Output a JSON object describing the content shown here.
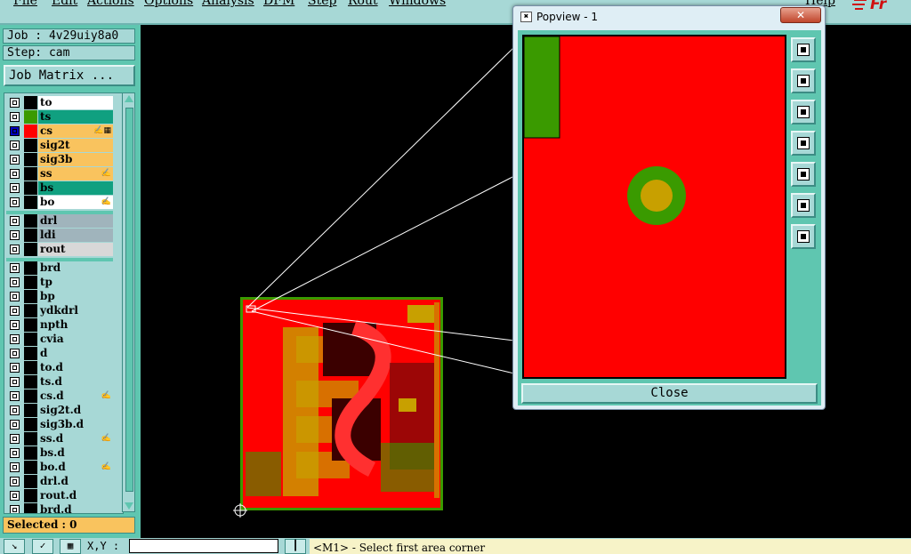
{
  "menu": {
    "items": [
      "File",
      "Edit",
      "Actions",
      "Options",
      "Analysis",
      "DFM",
      "Step",
      "Rout",
      "Windows"
    ],
    "help": "Help",
    "logo_text": "Fr"
  },
  "job_info": {
    "job": "Job : 4v29uiy8a0",
    "step": "Step: cam",
    "job_matrix_button": "Job Matrix ..."
  },
  "layers": [
    {
      "name": "to",
      "color": "#000000",
      "bg": "#ffffff",
      "mark": ""
    },
    {
      "name": "ts",
      "color": "#3a9a00",
      "bg": "#10a080",
      "mark": ""
    },
    {
      "name": "cs",
      "color": "#ff0000",
      "bg": "#f9c35e",
      "mark": "✍▦",
      "active": true
    },
    {
      "name": "sig2t",
      "color": "#000000",
      "bg": "#f9c35e",
      "mark": ""
    },
    {
      "name": "sig3b",
      "color": "#000000",
      "bg": "#f9c35e",
      "mark": ""
    },
    {
      "name": "ss",
      "color": "#000000",
      "bg": "#f9c35e",
      "mark": "✍"
    },
    {
      "name": "bs",
      "color": "#000000",
      "bg": "#10a080",
      "mark": ""
    },
    {
      "name": "bo",
      "color": "#000000",
      "bg": "#ffffff",
      "mark": "✍"
    },
    {
      "name": "drl",
      "color": "#000000",
      "bg": "#a0b4bc",
      "mark": ""
    },
    {
      "name": "ldi",
      "color": "#000000",
      "bg": "#a0b4bc",
      "mark": ""
    },
    {
      "name": "rout",
      "color": "#000000",
      "bg": "#d8d8d8",
      "mark": ""
    },
    {
      "name": "brd",
      "color": "#000000",
      "bg": "#a7d8d6",
      "mark": ""
    },
    {
      "name": "tp",
      "color": "#000000",
      "bg": "#a7d8d6",
      "mark": ""
    },
    {
      "name": "bp",
      "color": "#000000",
      "bg": "#a7d8d6",
      "mark": ""
    },
    {
      "name": "ydkdrl",
      "color": "#000000",
      "bg": "#a7d8d6",
      "mark": ""
    },
    {
      "name": "npth",
      "color": "#000000",
      "bg": "#a7d8d6",
      "mark": ""
    },
    {
      "name": "cvia",
      "color": "#000000",
      "bg": "#a7d8d6",
      "mark": ""
    },
    {
      "name": "d",
      "color": "#000000",
      "bg": "#a7d8d6",
      "mark": ""
    },
    {
      "name": "to.d",
      "color": "#000000",
      "bg": "#a7d8d6",
      "mark": ""
    },
    {
      "name": "ts.d",
      "color": "#000000",
      "bg": "#a7d8d6",
      "mark": ""
    },
    {
      "name": "cs.d",
      "color": "#000000",
      "bg": "#a7d8d6",
      "mark": "✍"
    },
    {
      "name": "sig2t.d",
      "color": "#000000",
      "bg": "#a7d8d6",
      "mark": ""
    },
    {
      "name": "sig3b.d",
      "color": "#000000",
      "bg": "#a7d8d6",
      "mark": ""
    },
    {
      "name": "ss.d",
      "color": "#000000",
      "bg": "#a7d8d6",
      "mark": "✍"
    },
    {
      "name": "bs.d",
      "color": "#000000",
      "bg": "#a7d8d6",
      "mark": ""
    },
    {
      "name": "bo.d",
      "color": "#000000",
      "bg": "#a7d8d6",
      "mark": "✍"
    },
    {
      "name": "drl.d",
      "color": "#000000",
      "bg": "#a7d8d6",
      "mark": ""
    },
    {
      "name": "rout.d",
      "color": "#000000",
      "bg": "#a7d8d6",
      "mark": ""
    },
    {
      "name": "brd.d",
      "color": "#000000",
      "bg": "#a7d8d6",
      "mark": ""
    }
  ],
  "selected": "Selected : 0",
  "bottom": {
    "xy_label": "X,Y :",
    "xy_value": "",
    "status": "<M1> - Select first area corner"
  },
  "popview": {
    "title": "Popview - 1",
    "close_x": "✕",
    "close_label": "Close"
  },
  "colors": {
    "panel_bg": "#5fc6b0",
    "panel_light": "#a7d8d6",
    "board_red": "#ff0000",
    "pad_green": "#3a9a00",
    "pad_gold": "#c8a000"
  }
}
